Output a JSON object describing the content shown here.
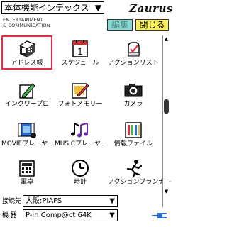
{
  "header": {
    "dropdown_value": "本体機能インデックス",
    "brand": "Zaurus",
    "tagline_line1": "ENTERTAINMENT",
    "tagline_line2": "& COMMUNICATION",
    "edit_label": "編集",
    "close_label": "閉じる"
  },
  "apps": [
    {
      "label": "アドレス帳",
      "icon": "phone-book-icon"
    },
    {
      "label": "スケジュール",
      "icon": "calendar-icon"
    },
    {
      "label": "アクションリスト",
      "icon": "checklist-hand-icon"
    },
    {
      "label": "インクワープロ",
      "icon": "pen-note-icon"
    },
    {
      "label": "フォトメモリー",
      "icon": "photo-memory-icon"
    },
    {
      "label": "カメラ",
      "icon": "camera-icon"
    },
    {
      "label": "MOVIEプレーヤー",
      "icon": "movie-player-icon"
    },
    {
      "label": "MUSICプレーヤー",
      "icon": "music-player-icon"
    },
    {
      "label": "情報ファイル",
      "icon": "info-file-icon"
    },
    {
      "label": "電卓",
      "icon": "calculator-icon"
    },
    {
      "label": "時計",
      "icon": "clock-icon"
    },
    {
      "label": "アクションプランナー",
      "icon": "action-planner-icon"
    }
  ],
  "selected_app": "アドレス帳",
  "footer": {
    "connection_label": "接続先",
    "connection_value": "大阪:PIAFS",
    "device_label": "機 器",
    "device_value": "P-in Comp@ct 64K"
  },
  "colors": {
    "edit_bg": "#86d8d0",
    "close_bg": "#f7ee5a",
    "selection_border": "#e23040",
    "plug_color": "#2a6fd6"
  }
}
